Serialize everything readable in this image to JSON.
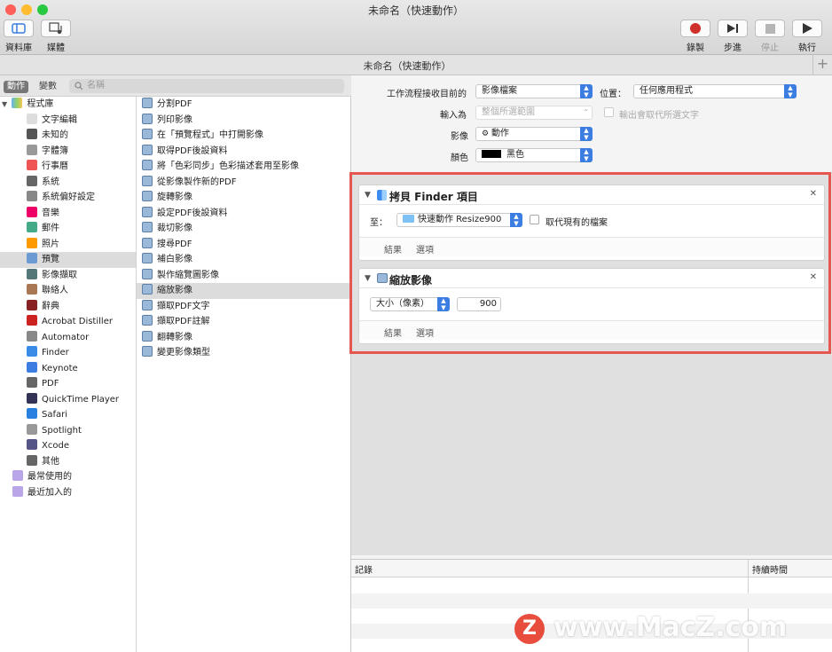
{
  "window": {
    "title": "未命名（快速動作）",
    "doc_title": "未命名（快速動作）"
  },
  "toolbar": {
    "library": "資料庫",
    "media": "媒體",
    "record": "錄製",
    "step": "步進",
    "stop": "停止",
    "run": "執行"
  },
  "left_bar": {
    "tab_actions": "動作",
    "tab_variables": "變數",
    "search_placeholder": "名稱"
  },
  "library": {
    "root": "程式庫",
    "items": [
      "文字編輯",
      "未知的",
      "字體簿",
      "行事曆",
      "系統",
      "系統偏好設定",
      "音樂",
      "郵件",
      "照片",
      "預覽",
      "影像擷取",
      "聯絡人",
      "辭典",
      "Acrobat Distiller",
      "Automator",
      "Finder",
      "Keynote",
      "PDF",
      "QuickTime Player",
      "Safari",
      "Spotlight",
      "Xcode",
      "其他"
    ],
    "recent": [
      "最常使用的",
      "最近加入的"
    ],
    "selected": "預覽"
  },
  "actions": {
    "items": [
      "分割PDF",
      "列印影像",
      "在「預覽程式」中打開影像",
      "取得PDF後設資料",
      "將「色彩同步」色彩描述套用至影像",
      "從影像製作新的PDF",
      "旋轉影像",
      "設定PDF後設資料",
      "裁切影像",
      "搜尋PDF",
      "補白影像",
      "製作縮覽圖影像",
      "縮放影像",
      "擷取PDF文字",
      "擷取PDF註解",
      "翻轉影像",
      "變更影像類型"
    ],
    "selected": "縮放影像"
  },
  "workflow": {
    "receives_label": "工作流程接收目前的",
    "receives_value": "影像檔案",
    "location_label": "位置：",
    "location_value": "任何應用程式",
    "input_label": "輸入為",
    "input_value": "整個所選範圍",
    "output_replace_label": "輸出會取代所選文字",
    "image_label": "影像",
    "image_value": "動作",
    "color_label": "顏色",
    "color_value": "黑色"
  },
  "copy_action": {
    "title": "拷貝 Finder 項目",
    "to_label": "至：",
    "to_value": "快速動作 Resize900",
    "replace_label": "取代現有的檔案",
    "results": "結果",
    "options": "選項"
  },
  "scale_action": {
    "title": "縮放影像",
    "mode_value": "大小（像素）",
    "size_value": "900",
    "results": "結果",
    "options": "選項"
  },
  "log": {
    "col_log": "記錄",
    "col_duration": "持續時間"
  },
  "watermark": {
    "text": "www.MacZ.com"
  },
  "colors": {
    "highlight": "#e8574f",
    "accent": "#3b7de0"
  }
}
